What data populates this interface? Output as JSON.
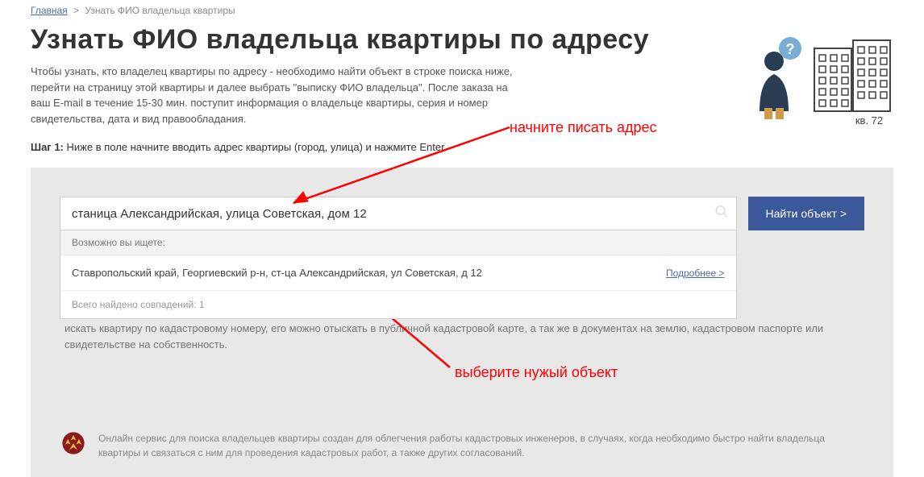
{
  "breadcrumb": {
    "home": "Главная",
    "current": "Узнать ФИО владельца квартиры"
  },
  "title": "Узнать ФИО владельца квартиры по адресу",
  "description": "Чтобы узнать, кто владелец квартиры по адресу - необходимо найти объект в строке поиска ниже, перейти на страницу этой квартиры и далее выбрать \"выписку ФИО владельца\". После заказа на ваш E-mail в течение 15-30 мин. поступит информация о владельце квартиры, серия и номер свидетельства, дата и вид правообладания.",
  "step": {
    "label": "Шаг 1:",
    "text": "Ниже в поле начните вводить адрес квартиры (город, улица) и нажмите Enter"
  },
  "search": {
    "value": "станица Александрийская, улица Советская, дом 12",
    "button": "Найти объект >"
  },
  "dropdown": {
    "header": "Возможно вы ищете:",
    "result_text": "Ставропольский край, Георгиевский р-н, ст-ца Александрийская, ул Советская, д 12",
    "more": "Подробнее >",
    "footer": "Всего найдено совпадений:  1"
  },
  "info_para": "искать квартиру по кадастровому номеру, его можно отыскать в публичной кадастровой карте, а так же в документах на землю, кадастровом паспорте или свидетельстве на собственность.",
  "footer_text": "Онлайн сервис для поиска владельцев квартиры создан для облегчения работы кадастровых инженеров, в случаях, когда необходимо быстро найти владельца квартиры и связаться с ним для проведения кадастровых работ, а также других согласований.",
  "illustration": {
    "apt_label": "кв. 72"
  },
  "annotations": {
    "top": "начните писать адрес",
    "bottom": "выберите нужый объект"
  }
}
